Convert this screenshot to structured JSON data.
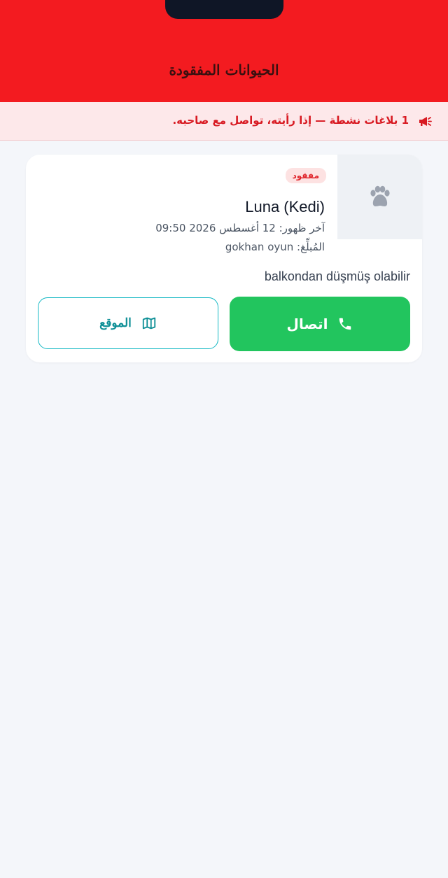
{
  "header": {
    "title": "الحيوانات المفقودة"
  },
  "banner": {
    "icon": "megaphone-icon",
    "text": "1 بلاغات نشطة — إذا رأيته، تواصل مع صاحبه."
  },
  "card": {
    "thumbnail_icon": "paw-icon",
    "status_badge": "مفقود",
    "pet_name": "Luna (Kedi)",
    "last_seen": "آخر ظهور: 12 أغسطس 2026 09:50",
    "reporter": "المُبلِّغ: gokhan oyun",
    "description": "balkondan düşmüş olabilir",
    "call_button": {
      "label": "اتصال",
      "icon": "phone-icon"
    },
    "location_button": {
      "label": "الموقع",
      "icon": "map-icon"
    }
  },
  "colors": {
    "header_bg": "#f31b20",
    "banner_bg": "#fde8ea",
    "banner_text": "#d81a22",
    "call_button_bg": "#22c55e",
    "location_button_border": "#14b8c4",
    "page_bg": "#f4f6fa"
  }
}
